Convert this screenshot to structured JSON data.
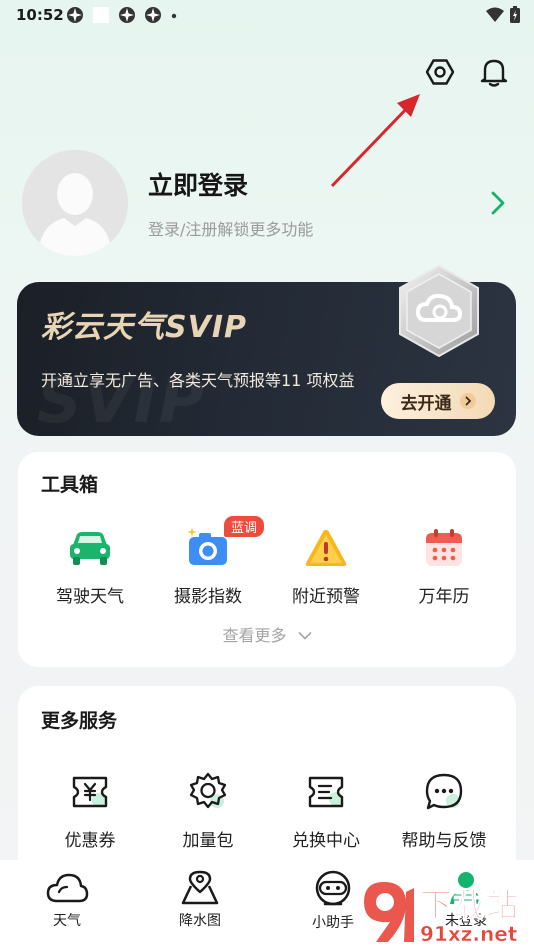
{
  "status_bar": {
    "time": "10:52"
  },
  "profile": {
    "title": "立即登录",
    "subtitle": "登录/注册解锁更多功能"
  },
  "vip": {
    "title": "彩云天气SVIP",
    "watermark": "SVIP",
    "description": "开通立享无广告、各类天气预报等11 项权益",
    "button_label": "去开通"
  },
  "toolbox": {
    "title": "工具箱",
    "items": [
      {
        "label": "驾驶天气",
        "icon": "car-icon"
      },
      {
        "label": "摄影指数",
        "icon": "camera-icon",
        "tag": "蓝调"
      },
      {
        "label": "附近预警",
        "icon": "warning-icon"
      },
      {
        "label": "万年历",
        "icon": "calendar-icon"
      }
    ],
    "see_more": "查看更多"
  },
  "services": {
    "title": "更多服务",
    "items": [
      {
        "label": "优惠券",
        "icon": "coupon-icon"
      },
      {
        "label": "加量包",
        "icon": "gear-pack-icon"
      },
      {
        "label": "兑换中心",
        "icon": "exchange-icon"
      },
      {
        "label": "帮助与反馈",
        "icon": "chat-icon"
      }
    ]
  },
  "bottom_nav": {
    "items": [
      {
        "label": "天气",
        "icon": "cloud-icon"
      },
      {
        "label": "降水图",
        "icon": "map-pin-icon"
      },
      {
        "label": "小助手",
        "icon": "assistant-icon"
      },
      {
        "label": "未登录",
        "icon": "user-icon"
      }
    ]
  },
  "watermark": {
    "text1": "下载站",
    "text2": "91xz.net"
  },
  "colors": {
    "accent_green": "#16b36e",
    "arrow_red": "#d9262c",
    "vip_gold": "#e8d5b5",
    "tag_red": "#ef4a3c"
  }
}
